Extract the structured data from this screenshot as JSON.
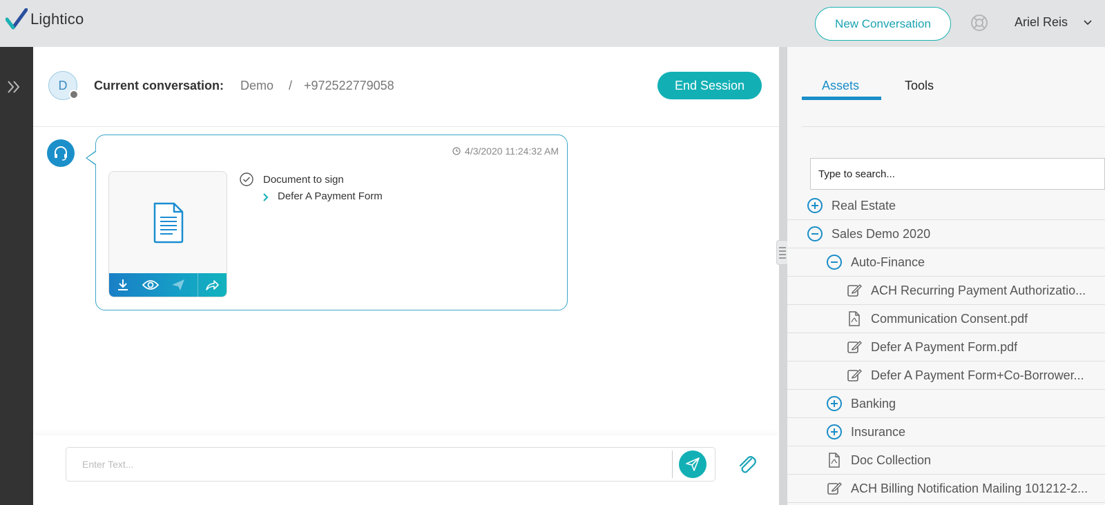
{
  "header": {
    "logo_text": "Lightico",
    "new_conversation_label": "New Conversation",
    "user_name": "Ariel Reis",
    "accent_color": "#12b0b5"
  },
  "conversation": {
    "avatar_initial": "D",
    "label": "Current conversation:",
    "name": "Demo",
    "separator": "/",
    "phone": "+972522779058",
    "end_session_label": "End Session"
  },
  "message": {
    "timestamp": "4/3/2020 11:24:32 AM",
    "title": "Document to sign",
    "document_name": "Defer A Payment Form"
  },
  "compose": {
    "placeholder": "Enter Text..."
  },
  "panel": {
    "tabs": [
      {
        "label": "Assets",
        "active": true
      },
      {
        "label": "Tools",
        "active": false
      }
    ],
    "search_placeholder": "Type to search...",
    "tree": [
      {
        "label": "Real Estate",
        "icon": "plus-circle-icon",
        "level": 0
      },
      {
        "label": "Sales Demo 2020",
        "icon": "minus-circle-icon",
        "level": 0
      },
      {
        "label": "Auto-Finance",
        "icon": "minus-circle-icon",
        "level": 1
      },
      {
        "label": "ACH Recurring Payment Authorizatio...",
        "icon": "edit-doc-icon",
        "level": 2
      },
      {
        "label": "Communication Consent.pdf",
        "icon": "pdf-icon",
        "level": 2
      },
      {
        "label": "Defer A Payment Form.pdf",
        "icon": "edit-doc-icon",
        "level": 2
      },
      {
        "label": "Defer A Payment Form+Co-Borrower...",
        "icon": "edit-doc-icon",
        "level": 2
      },
      {
        "label": "Banking",
        "icon": "plus-circle-icon",
        "level": 1
      },
      {
        "label": "Insurance",
        "icon": "plus-circle-icon",
        "level": 1
      },
      {
        "label": "Doc Collection",
        "icon": "pdf-icon",
        "level": 1
      },
      {
        "label": "ACH Billing Notification Mailing 101212-2...",
        "icon": "edit-doc-icon",
        "level": 1
      }
    ]
  }
}
